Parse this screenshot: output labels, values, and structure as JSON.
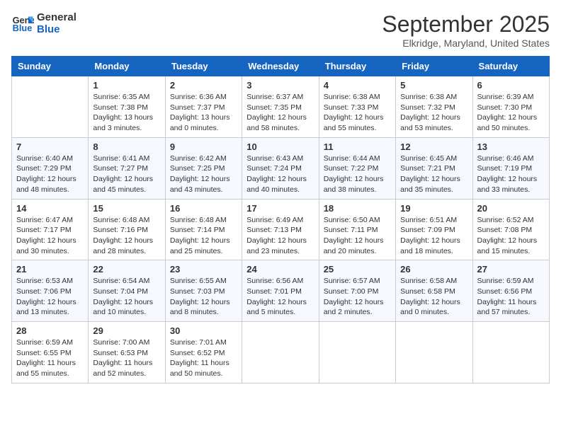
{
  "logo": {
    "line1": "General",
    "line2": "Blue"
  },
  "title": "September 2025",
  "location": "Elkridge, Maryland, United States",
  "days_of_week": [
    "Sunday",
    "Monday",
    "Tuesday",
    "Wednesday",
    "Thursday",
    "Friday",
    "Saturday"
  ],
  "weeks": [
    [
      {
        "day": "",
        "info": ""
      },
      {
        "day": "1",
        "info": "Sunrise: 6:35 AM\nSunset: 7:38 PM\nDaylight: 13 hours\nand 3 minutes."
      },
      {
        "day": "2",
        "info": "Sunrise: 6:36 AM\nSunset: 7:37 PM\nDaylight: 13 hours\nand 0 minutes."
      },
      {
        "day": "3",
        "info": "Sunrise: 6:37 AM\nSunset: 7:35 PM\nDaylight: 12 hours\nand 58 minutes."
      },
      {
        "day": "4",
        "info": "Sunrise: 6:38 AM\nSunset: 7:33 PM\nDaylight: 12 hours\nand 55 minutes."
      },
      {
        "day": "5",
        "info": "Sunrise: 6:38 AM\nSunset: 7:32 PM\nDaylight: 12 hours\nand 53 minutes."
      },
      {
        "day": "6",
        "info": "Sunrise: 6:39 AM\nSunset: 7:30 PM\nDaylight: 12 hours\nand 50 minutes."
      }
    ],
    [
      {
        "day": "7",
        "info": "Sunrise: 6:40 AM\nSunset: 7:29 PM\nDaylight: 12 hours\nand 48 minutes."
      },
      {
        "day": "8",
        "info": "Sunrise: 6:41 AM\nSunset: 7:27 PM\nDaylight: 12 hours\nand 45 minutes."
      },
      {
        "day": "9",
        "info": "Sunrise: 6:42 AM\nSunset: 7:25 PM\nDaylight: 12 hours\nand 43 minutes."
      },
      {
        "day": "10",
        "info": "Sunrise: 6:43 AM\nSunset: 7:24 PM\nDaylight: 12 hours\nand 40 minutes."
      },
      {
        "day": "11",
        "info": "Sunrise: 6:44 AM\nSunset: 7:22 PM\nDaylight: 12 hours\nand 38 minutes."
      },
      {
        "day": "12",
        "info": "Sunrise: 6:45 AM\nSunset: 7:21 PM\nDaylight: 12 hours\nand 35 minutes."
      },
      {
        "day": "13",
        "info": "Sunrise: 6:46 AM\nSunset: 7:19 PM\nDaylight: 12 hours\nand 33 minutes."
      }
    ],
    [
      {
        "day": "14",
        "info": "Sunrise: 6:47 AM\nSunset: 7:17 PM\nDaylight: 12 hours\nand 30 minutes."
      },
      {
        "day": "15",
        "info": "Sunrise: 6:48 AM\nSunset: 7:16 PM\nDaylight: 12 hours\nand 28 minutes."
      },
      {
        "day": "16",
        "info": "Sunrise: 6:48 AM\nSunset: 7:14 PM\nDaylight: 12 hours\nand 25 minutes."
      },
      {
        "day": "17",
        "info": "Sunrise: 6:49 AM\nSunset: 7:13 PM\nDaylight: 12 hours\nand 23 minutes."
      },
      {
        "day": "18",
        "info": "Sunrise: 6:50 AM\nSunset: 7:11 PM\nDaylight: 12 hours\nand 20 minutes."
      },
      {
        "day": "19",
        "info": "Sunrise: 6:51 AM\nSunset: 7:09 PM\nDaylight: 12 hours\nand 18 minutes."
      },
      {
        "day": "20",
        "info": "Sunrise: 6:52 AM\nSunset: 7:08 PM\nDaylight: 12 hours\nand 15 minutes."
      }
    ],
    [
      {
        "day": "21",
        "info": "Sunrise: 6:53 AM\nSunset: 7:06 PM\nDaylight: 12 hours\nand 13 minutes."
      },
      {
        "day": "22",
        "info": "Sunrise: 6:54 AM\nSunset: 7:04 PM\nDaylight: 12 hours\nand 10 minutes."
      },
      {
        "day": "23",
        "info": "Sunrise: 6:55 AM\nSunset: 7:03 PM\nDaylight: 12 hours\nand 8 minutes."
      },
      {
        "day": "24",
        "info": "Sunrise: 6:56 AM\nSunset: 7:01 PM\nDaylight: 12 hours\nand 5 minutes."
      },
      {
        "day": "25",
        "info": "Sunrise: 6:57 AM\nSunset: 7:00 PM\nDaylight: 12 hours\nand 2 minutes."
      },
      {
        "day": "26",
        "info": "Sunrise: 6:58 AM\nSunset: 6:58 PM\nDaylight: 12 hours\nand 0 minutes."
      },
      {
        "day": "27",
        "info": "Sunrise: 6:59 AM\nSunset: 6:56 PM\nDaylight: 11 hours\nand 57 minutes."
      }
    ],
    [
      {
        "day": "28",
        "info": "Sunrise: 6:59 AM\nSunset: 6:55 PM\nDaylight: 11 hours\nand 55 minutes."
      },
      {
        "day": "29",
        "info": "Sunrise: 7:00 AM\nSunset: 6:53 PM\nDaylight: 11 hours\nand 52 minutes."
      },
      {
        "day": "30",
        "info": "Sunrise: 7:01 AM\nSunset: 6:52 PM\nDaylight: 11 hours\nand 50 minutes."
      },
      {
        "day": "",
        "info": ""
      },
      {
        "day": "",
        "info": ""
      },
      {
        "day": "",
        "info": ""
      },
      {
        "day": "",
        "info": ""
      }
    ]
  ]
}
